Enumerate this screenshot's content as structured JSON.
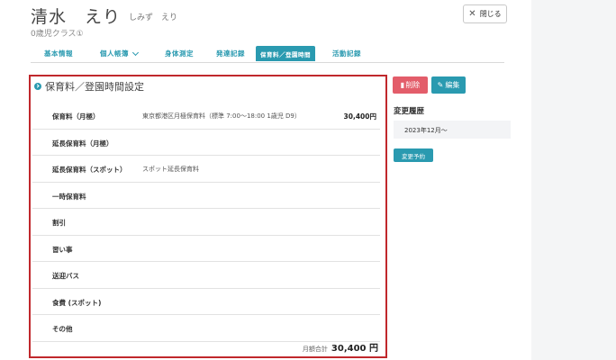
{
  "header": {
    "name": "清水　えり",
    "kana": "しみず　えり",
    "class_label": "0歳児クラス①",
    "close_label": "閉じる"
  },
  "tabs": [
    {
      "label": "基本情報"
    },
    {
      "label": "個人帳簿"
    },
    {
      "label": "身体測定"
    },
    {
      "label": "発達記録"
    },
    {
      "label": "保育料／登園時間"
    },
    {
      "label": "活動記録"
    }
  ],
  "section": {
    "title": "保育料／登園時間設定",
    "rows": [
      {
        "label": "保育料（月極）",
        "desc": "東京都港区月極保育料（標準 7:00〜18:00 1歳児 D9）",
        "amount": "30,400円"
      },
      {
        "label": "延長保育料（月極）",
        "desc": "",
        "amount": ""
      },
      {
        "label": "延長保育料（スポット）",
        "desc": "スポット延長保育料",
        "amount": ""
      },
      {
        "label": "一時保育料",
        "desc": "",
        "amount": ""
      },
      {
        "label": "割引",
        "desc": "",
        "amount": ""
      },
      {
        "label": "習い事",
        "desc": "",
        "amount": ""
      },
      {
        "label": "送迎バス",
        "desc": "",
        "amount": ""
      },
      {
        "label": "食費 (スポット)",
        "desc": "",
        "amount": ""
      },
      {
        "label": "その他",
        "desc": "",
        "amount": ""
      }
    ],
    "total_label": "月額合計",
    "total_value": "30,400 円"
  },
  "sidebar": {
    "delete_label": "削除",
    "edit_label": "編集",
    "history_title": "変更履歴",
    "history_items": [
      "2023年12月〜"
    ],
    "schedule_label": "変更予約"
  },
  "colors": {
    "accent": "#2a9ab0",
    "danger": "#e35d6a",
    "highlight_border": "#c0282c"
  }
}
